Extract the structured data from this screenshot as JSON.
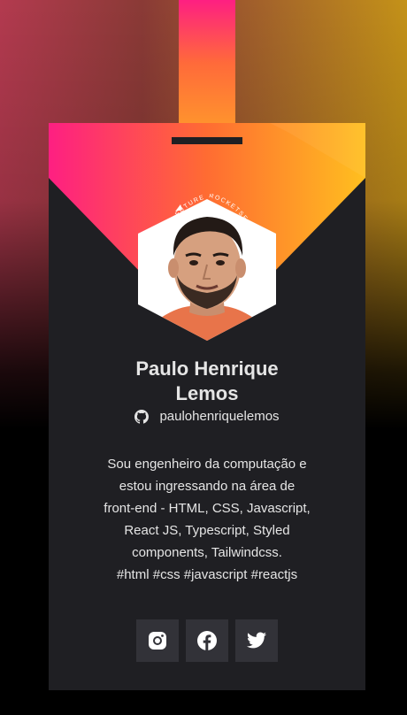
{
  "profile": {
    "name_line1": "Paulo Henrique",
    "name_line2": "Lemos",
    "github_username": "paulohenriquelemos",
    "badge_text_left": "LD THE FUTURE",
    "badge_text_right": "ROCKETSEAT",
    "bio_lines": [
      "Sou engenheiro da computação e",
      "estou ingressando na área de",
      "front-end - HTML, CSS, Javascript,",
      "React JS, Typescript, Styled",
      "components, Tailwindcss.",
      "#html #css #javascript #reactjs"
    ]
  },
  "socials": {
    "items": [
      {
        "name": "instagram",
        "icon": "instagram-icon"
      },
      {
        "name": "facebook",
        "icon": "facebook-icon"
      },
      {
        "name": "twitter",
        "icon": "twitter-icon"
      }
    ]
  },
  "colors": {
    "card": "#1f1f23",
    "button": "#323238",
    "text": "#e5e5e5",
    "gradient_start": "#fe1f82",
    "gradient_end": "#ffbf1f"
  }
}
